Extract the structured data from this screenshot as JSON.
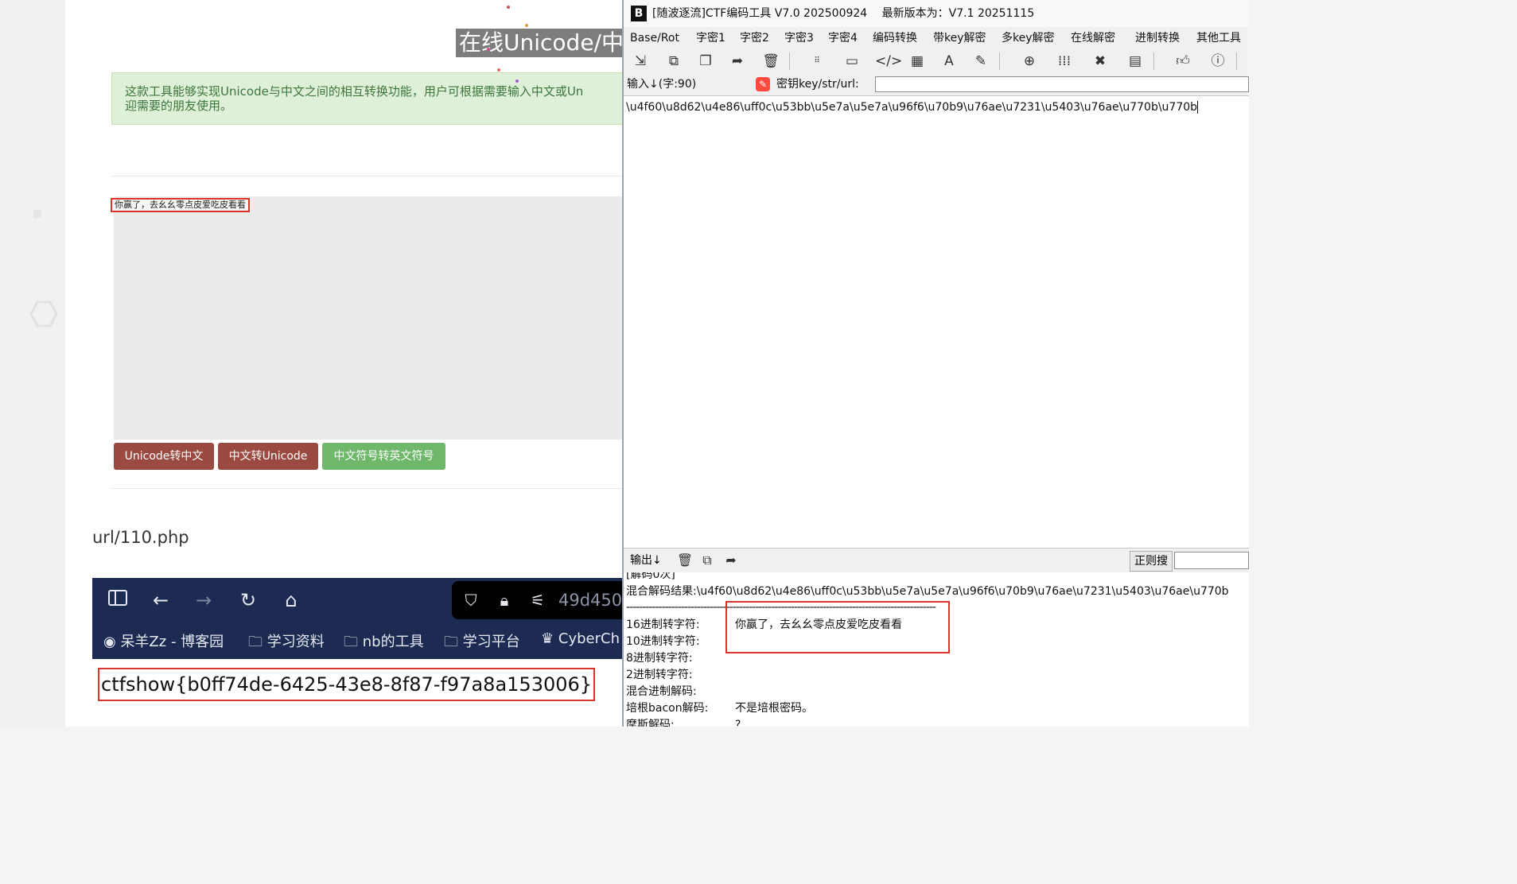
{
  "website": {
    "title": "在线Unicode/中",
    "description_line1": "这款工具能够实现Unicode与中文之间的相互转换功能，用户可根据需要输入中文或Un",
    "description_line2": "迎需要的朋友使用。",
    "textarea_text": "你赢了，去幺幺零点皮爱吃皮看看",
    "buttons": [
      "Unicode转中文",
      "中文转Unicode",
      "中文符号转英文符号"
    ],
    "url_label": "url/110.php",
    "flag": "ctfshow{b0ff74de-6425-43e8-8f87-f97a8a153006}"
  },
  "browser": {
    "url_partial": "49d450",
    "bookmarks": [
      "呆羊Zz - 博客园",
      "学习资料",
      "nb的工具",
      "学习平台",
      "CyberCh"
    ]
  },
  "app": {
    "title": "[随波逐流]CTF编码工具 V7.0 202500924",
    "latest_version": "最新版本为：V7.1  20251115",
    "menu": [
      "Base/Rot",
      "字密1",
      "字密2",
      "字密3",
      "字密4",
      "编码转换",
      "带key解密",
      "多key解密",
      "在线解密",
      "进制转换",
      "其他工具"
    ],
    "input_label": "输入↓(字:90)",
    "key_label": "密钥key/str/url:",
    "input_text": "\\u4f60\\u8d62\\u4e86\\uff0c\\u53bb\\u5e7a\\u5e7a\\u96f6\\u70b9\\u76ae\\u7231\\u5403\\u76ae\\u770b\\u770b",
    "output_label": "输出↓",
    "regex_label": "正则搜",
    "output_top_partial": "[解码0次]",
    "mixed_label": "混合解码结果:",
    "mixed_value": "\\u4f60\\u8d62\\u4e86\\uff0c\\u53bb\\u5e7a\\u5e7a\\u96f6\\u70b9\\u76ae\\u7231\\u5403\\u76ae\\u770b",
    "separator": "------------------------------------------------------------------------------------------------",
    "rows": [
      {
        "label": "16进制转字符:",
        "value": "你赢了，去幺幺零点皮爱吃皮看看"
      },
      {
        "label": "10进制转字符:",
        "value": ""
      },
      {
        "label": "8进制转字符:",
        "value": ""
      },
      {
        "label": "2进制转字符:",
        "value": ""
      },
      {
        "label": "混合进制解码:",
        "value": ""
      },
      {
        "label": "培根bacon解码:",
        "value": "不是培根密码。"
      },
      {
        "label": "摩斯解码:",
        "value": "?"
      }
    ]
  }
}
